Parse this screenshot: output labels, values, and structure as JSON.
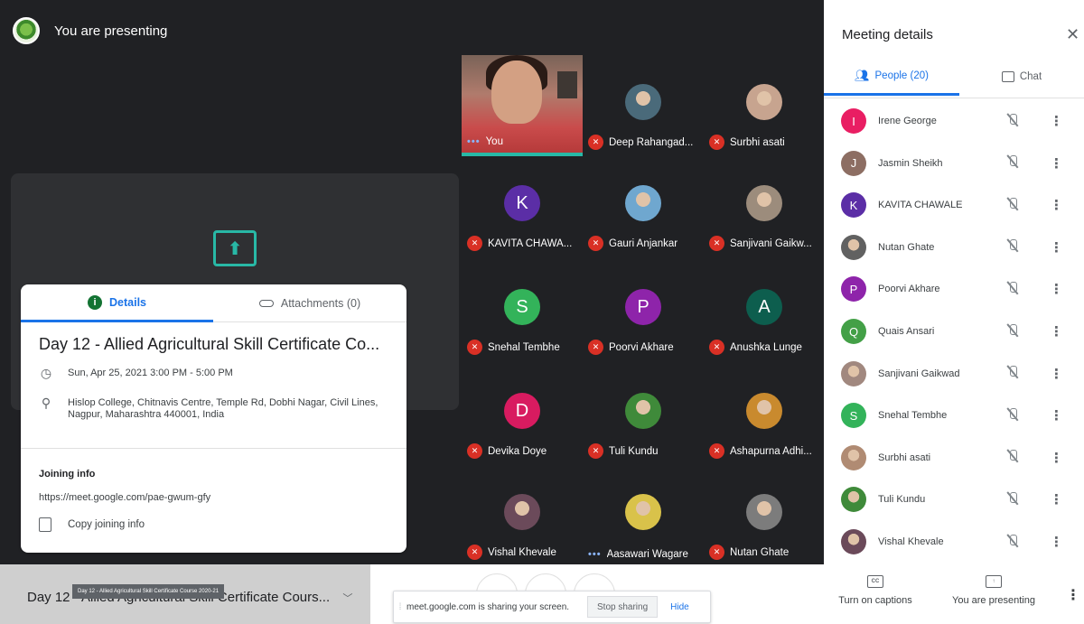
{
  "banner": {
    "text": "You are presenting"
  },
  "share_icon": {
    "glyph": "⬆"
  },
  "tiles": [
    {
      "name": "You",
      "type": "video",
      "status": "dots"
    },
    {
      "name": "Deep Rahangad...",
      "type": "photo",
      "color": "#4a6a7a",
      "muted": true
    },
    {
      "name": "Surbhi asati",
      "type": "photo",
      "color": "#c7a48f",
      "muted": true
    },
    {
      "name": "KAVITA CHAWA...",
      "type": "letter",
      "letter": "K",
      "color": "#5b2ea6",
      "muted": true
    },
    {
      "name": "Gauri Anjankar",
      "type": "photo",
      "color": "#6fa7cf",
      "muted": true
    },
    {
      "name": "Sanjivani Gaikw...",
      "type": "photo",
      "color": "#9c8c7c",
      "muted": true
    },
    {
      "name": "Snehal Tembhe",
      "type": "letter",
      "letter": "S",
      "color": "#33b35a",
      "muted": true
    },
    {
      "name": "Poorvi Akhare",
      "type": "letter",
      "letter": "P",
      "color": "#8e24aa",
      "muted": true
    },
    {
      "name": "Anushka Lunge",
      "type": "letter",
      "letter": "A",
      "color": "#0d5e4e",
      "muted": true
    },
    {
      "name": "Devika Doye",
      "type": "letter",
      "letter": "D",
      "color": "#d81b60",
      "muted": true
    },
    {
      "name": "Tuli Kundu",
      "type": "photo",
      "color": "#3f8a3a",
      "muted": true
    },
    {
      "name": "Ashapurna Adhi...",
      "type": "photo",
      "color": "#c98a2e",
      "muted": true
    },
    {
      "name": "Vishal Khevale",
      "type": "photo",
      "color": "#6b4a5a",
      "muted": true
    },
    {
      "name": "Aasawari Wagare",
      "type": "photo",
      "color": "#d9c24a",
      "status": "dots"
    },
    {
      "name": "Nutan Ghate",
      "type": "photo",
      "color": "#7c7c7c",
      "muted": true
    }
  ],
  "details": {
    "tab_details": "Details",
    "tab_attachments": "Attachments (0)",
    "title": "Day 12 - Allied Agricultural Skill Certificate Co...",
    "datetime": "Sun, Apr 25, 2021 3:00 PM - 5:00 PM",
    "location": "Hislop College, Chitnavis Centre, Temple Rd, Dobhi Nagar, Civil Lines, Nagpur, Maharashtra 440001, India",
    "joining_title": "Joining info",
    "joining_link": "https://meet.google.com/pae-gwum-gfy",
    "copy_label": "Copy joining info"
  },
  "bottom": {
    "meeting_short": "Day 12 - Allied Agricultural Skill Certificate Cours...",
    "tooltip": "Day 12 - Allied Agricultural Skill Certificate Course 2020-21",
    "share_notice": "meet.google.com is sharing your screen.",
    "stop_sharing": "Stop sharing",
    "hide": "Hide",
    "captions_label": "Turn on captions",
    "captions_icon": "CC",
    "present_label": "You are presenting"
  },
  "panel": {
    "title": "Meeting details",
    "tab_people": "People (20)",
    "tab_chat": "Chat",
    "people": [
      {
        "name": "Irene George",
        "type": "letter",
        "letter": "I",
        "color": "#e91e63"
      },
      {
        "name": "Jasmin Sheikh",
        "type": "letter",
        "letter": "J",
        "color": "#8d6e63"
      },
      {
        "name": "KAVITA CHAWALE",
        "type": "letter",
        "letter": "K",
        "color": "#5b2ea6"
      },
      {
        "name": "Nutan Ghate",
        "type": "photo",
        "color": "#616161"
      },
      {
        "name": "Poorvi Akhare",
        "type": "letter",
        "letter": "P",
        "color": "#8e24aa"
      },
      {
        "name": "Quais Ansari",
        "type": "letter",
        "letter": "Q",
        "color": "#43a047"
      },
      {
        "name": "Sanjivani Gaikwad",
        "type": "photo",
        "color": "#a1887f"
      },
      {
        "name": "Snehal Tembhe",
        "type": "letter",
        "letter": "S",
        "color": "#33b35a"
      },
      {
        "name": "Surbhi asati",
        "type": "photo",
        "color": "#b08b73"
      },
      {
        "name": "Tuli Kundu",
        "type": "photo",
        "color": "#3f8a3a"
      },
      {
        "name": "Vishal Khevale",
        "type": "photo",
        "color": "#6b4a5a"
      }
    ]
  }
}
